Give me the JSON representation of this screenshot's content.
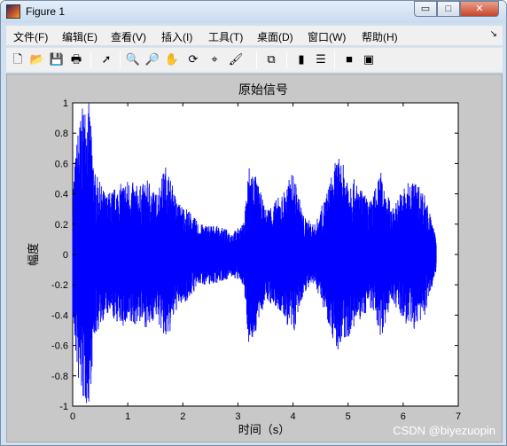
{
  "window": {
    "title": "Figure 1",
    "buttons": {
      "minimize": "▭",
      "maximize": "□",
      "close": "✕"
    }
  },
  "menu": {
    "items": [
      "文件(F)",
      "编辑(E)",
      "查看(V)",
      "插入(I)",
      "工具(T)",
      "桌面(D)",
      "窗口(W)",
      "帮助(H)"
    ],
    "overflow": "↘"
  },
  "toolbar": {
    "icons": [
      {
        "name": "new-figure-icon",
        "glyph": "🗋"
      },
      {
        "name": "open-file-icon",
        "glyph": "📂"
      },
      {
        "name": "save-icon",
        "glyph": "💾"
      },
      {
        "name": "print-icon",
        "glyph": "🖶"
      },
      {
        "name": "edit-plot-icon",
        "glyph": "➚"
      },
      {
        "name": "zoom-in-icon",
        "glyph": "🔍"
      },
      {
        "name": "zoom-out-icon",
        "glyph": "🔎"
      },
      {
        "name": "pan-icon",
        "glyph": "✋"
      },
      {
        "name": "rotate-3d-icon",
        "glyph": "⟳"
      },
      {
        "name": "data-cursor-icon",
        "glyph": "⌖"
      },
      {
        "name": "brush-icon",
        "glyph": "🖌"
      },
      {
        "name": "link-plot-icon",
        "glyph": "⧉"
      },
      {
        "name": "colorbar-icon",
        "glyph": "▮"
      },
      {
        "name": "legend-icon",
        "glyph": "☰"
      },
      {
        "name": "hide-plot-tools-icon",
        "glyph": "■"
      },
      {
        "name": "show-plot-tools-icon",
        "glyph": "▣"
      }
    ]
  },
  "colors": {
    "signal": "#0000ff",
    "figure_bg": "#c8c8c8",
    "axes_bg": "#ffffff"
  },
  "chart_data": {
    "type": "line",
    "title": "原始信号",
    "xlabel": "时间（s）",
    "ylabel": "幅度",
    "xlim": [
      0,
      7
    ],
    "ylim": [
      -1,
      1
    ],
    "x_ticks": [
      "0",
      "1",
      "2",
      "3",
      "4",
      "5",
      "6",
      "7"
    ],
    "y_ticks": [
      "1",
      "0.8",
      "0.6",
      "0.4",
      "0.2",
      "0",
      "-0.2",
      "-0.4",
      "-0.6",
      "-0.8",
      "-1"
    ],
    "grid": false,
    "series": [
      {
        "color": "#0000ff",
        "x": [
          0.0,
          0.1,
          0.2,
          0.25,
          0.3,
          0.4,
          0.6,
          0.8,
          1.0,
          1.2,
          1.4,
          1.5,
          1.7,
          1.9,
          2.1,
          2.3,
          2.5,
          2.7,
          2.9,
          3.1,
          3.2,
          3.3,
          3.5,
          3.8,
          4.0,
          4.2,
          4.4,
          4.6,
          4.8,
          5.0,
          5.2,
          5.4,
          5.6,
          5.8,
          6.0,
          6.2,
          6.4,
          6.6
        ],
        "envelope": [
          0.45,
          0.85,
          1.0,
          1.0,
          1.0,
          0.55,
          0.4,
          0.45,
          0.5,
          0.45,
          0.5,
          0.4,
          0.6,
          0.35,
          0.3,
          0.2,
          0.2,
          0.18,
          0.15,
          0.2,
          0.6,
          0.55,
          0.3,
          0.4,
          0.55,
          0.25,
          0.2,
          0.4,
          0.65,
          0.55,
          0.45,
          0.35,
          0.55,
          0.3,
          0.45,
          0.5,
          0.4,
          0.1
        ]
      }
    ]
  },
  "watermark": "CSDN @biyezuopin"
}
